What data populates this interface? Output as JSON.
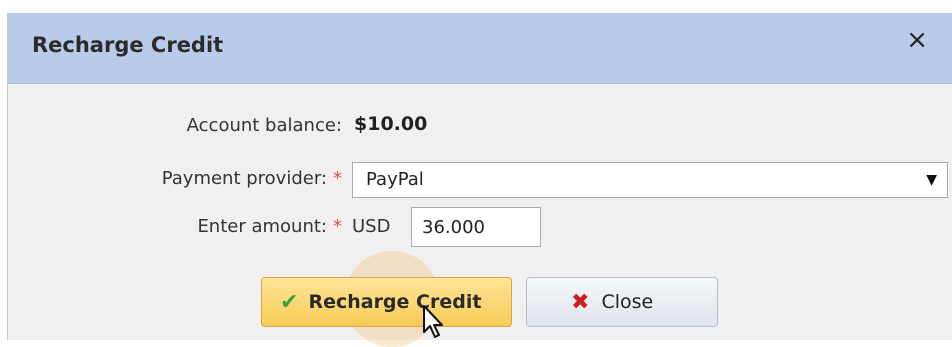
{
  "dialog": {
    "title": "Recharge Credit",
    "close_icon": "×"
  },
  "form": {
    "account_balance_label": "Account balance:",
    "account_balance_value": "$10.00",
    "payment_provider_label": "Payment provider:",
    "payment_provider_required": "*",
    "payment_provider_value": "PayPal",
    "enter_amount_label": "Enter amount:",
    "enter_amount_required": "*",
    "currency": "USD",
    "amount_value": "36.000"
  },
  "buttons": {
    "recharge_label": "Recharge Credit",
    "recharge_icon": "check-icon",
    "close_label": "Close",
    "close_icon": "x-icon"
  },
  "colors": {
    "titlebar": "#b8cbe8",
    "required": "#e0533a",
    "recharge_button": "#f7cb55",
    "check": "#3aa23a",
    "close_x": "#cc2020"
  }
}
